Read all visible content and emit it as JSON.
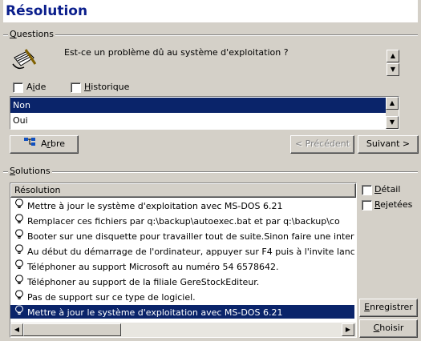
{
  "window": {
    "title": "Résolution"
  },
  "questions": {
    "group_label": "Questions",
    "question_text": "Est-ce un problème dû au système d'exploitation ?",
    "checkboxes": [
      {
        "label": "Aide",
        "checked": false
      },
      {
        "label": "Historique",
        "checked": false
      }
    ],
    "answers": [
      "Non",
      "Oui"
    ],
    "selected_answer": "Non"
  },
  "nav": {
    "tree_label": "Arbre",
    "prev_label": "< Précédent",
    "next_label": "Suivant >"
  },
  "solutions": {
    "group_label": "Solutions",
    "column_header": "Résolution",
    "rows": [
      "Mettre à jour le système d'exploitation avec MS-DOS 6.21",
      "Remplacer ces fichiers par q:\\backup\\autoexec.bat et par q:\\backup\\co",
      "Booter sur une disquette pour travailler tout de suite.Sinon faire une interv",
      "Au début du démarrage de l'ordinateur, appuyer sur F4 puis à l'invite lance",
      "Téléphoner au support Microsoft au numéro 54 6578642.",
      "Téléphoner au support de la filiale GereStockEditeur.",
      "Pas de support sur ce type de logiciel.",
      "Mettre à jour le système d'exploitation avec MS-DOS 6.21"
    ],
    "selected_index": 7,
    "side_checkboxes": [
      {
        "label": "Détail",
        "checked": false
      },
      {
        "label": "Rejetées",
        "checked": false
      }
    ],
    "save_label": "Enregistrer",
    "choose_label": "Choisir"
  },
  "colors": {
    "title": "#0a1e8c",
    "selection": "#0a246a",
    "face": "#d4d0c8"
  }
}
